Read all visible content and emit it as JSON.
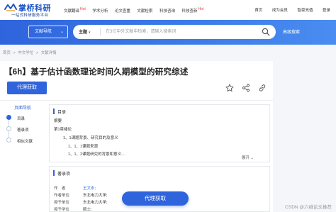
{
  "header": {
    "logo_title": "掌桥科研",
    "logo_subtitle": "一站式科研服务平台",
    "nav": [
      {
        "label": "文献翻译",
        "badge": "Hot"
      },
      {
        "label": "学术分析",
        "badge": ""
      },
      {
        "label": "论文查重",
        "badge": ""
      },
      {
        "label": "文献检索",
        "badge": ""
      },
      {
        "label": "科技咨询",
        "badge": ""
      },
      {
        "label": "科技查新",
        "badge": "Hot"
      }
    ],
    "right_links": [
      "首页",
      "成为会员",
      "智豪充值",
      "登录"
    ]
  },
  "search": {
    "doc_nav_label": "文献导航",
    "subject_label": "主题",
    "placeholder": "在3亿中外文献中检索，请输入搜索词",
    "advanced_label": "高级搜索"
  },
  "breadcrumb": [
    "首页",
    ">",
    "中文学位",
    ">",
    "文献详情"
  ],
  "paper": {
    "title": "【6h】基于估计函数理论时间久期模型的研究综述",
    "proxy_button": "代理获取"
  },
  "page_nav": {
    "title": "页面导航",
    "items": [
      "目录",
      "著录项",
      "相似文献"
    ]
  },
  "toc": {
    "title": "目录",
    "lines": [
      "摘要",
      "第1章绪论",
      "1、1课题背景、研究目的及意义",
      "1、1、1课题来源",
      "1、1、2课题研究的背景和意义..."
    ],
    "expand_label": "展开"
  },
  "authors": {
    "title": "著录项",
    "fields": [
      {
        "label": "作　者",
        "value": "王文永;"
      },
      {
        "label": "作者单位",
        "value": "东北电力大学;"
      },
      {
        "label": "授予单位",
        "value": "东北电力大学;"
      },
      {
        "label": "授予学位",
        "value": "硕士;"
      }
    ]
  },
  "float_button": "代理获取",
  "watermark": "CSDN @六维论文推荐",
  "colors": {
    "primary": "#2f64dc",
    "hot": "#e53935"
  }
}
